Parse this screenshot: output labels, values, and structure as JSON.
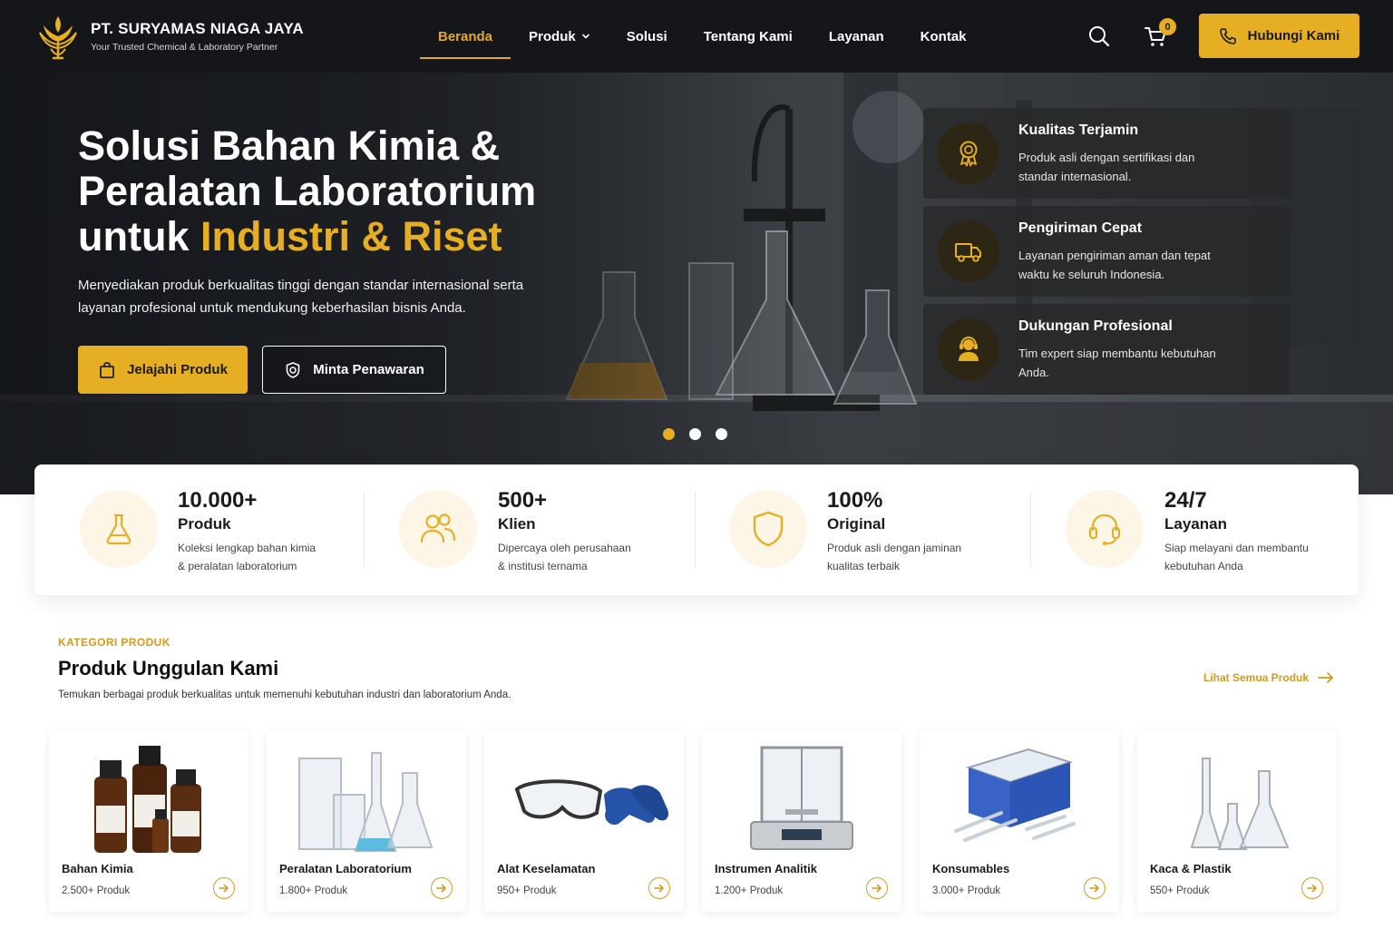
{
  "colors": {
    "accent": "#e6ae22",
    "nav_bg": "#14161a",
    "text_dark": "#1b1b1b"
  },
  "brand": {
    "name": "PT. SURYAMAS NIAGA JAYA",
    "tagline": "Your Trusted Chemical & Laboratory Partner",
    "logo_icon": "lotus-logo-icon"
  },
  "nav": {
    "items": [
      {
        "label": "Beranda",
        "active": true
      },
      {
        "label": "Produk",
        "dropdown": true
      },
      {
        "label": "Solusi"
      },
      {
        "label": "Tentang Kami"
      },
      {
        "label": "Layanan"
      },
      {
        "label": "Kontak"
      }
    ],
    "cart_count": "0",
    "cta_label": "Hubungi Kami"
  },
  "hero": {
    "title_line1": "Solusi Bahan Kimia &",
    "title_line2": "Peralatan Laboratorium",
    "title_line3_prefix": "untuk ",
    "title_line3_accent": "Industri & Riset",
    "description": "Menyediakan produk berkualitas tinggi dengan standar internasional serta layanan profesional untuk mendukung keberhasilan bisnis Anda.",
    "primary_button": "Jelajahi Produk",
    "secondary_button": "Minta Penawaran",
    "slide_count": 3,
    "active_slide": 1,
    "features": [
      {
        "title": "Kualitas Terjamin",
        "desc": "Produk asli dengan sertifikasi dan standar internasional.",
        "icon": "award-icon"
      },
      {
        "title": "Pengiriman Cepat",
        "desc": "Layanan pengiriman aman dan tepat waktu ke seluruh Indonesia.",
        "icon": "truck-icon"
      },
      {
        "title": "Dukungan Profesional",
        "desc": "Tim expert siap membantu kebutuhan Anda.",
        "icon": "support-agent-icon"
      }
    ]
  },
  "stats": [
    {
      "value": "10.000+",
      "label": "Produk",
      "desc_line1": "Koleksi lengkap bahan kimia",
      "desc_line2": "& peralatan laboratorium",
      "icon": "flask-icon"
    },
    {
      "value": "500+",
      "label": "Klien",
      "desc_line1": "Dipercaya oleh perusahaan",
      "desc_line2": "& institusi ternama",
      "icon": "users-icon"
    },
    {
      "value": "100%",
      "label": "Original",
      "desc_line1": "Produk asli dengan jaminan",
      "desc_line2": "kualitas terbaik",
      "icon": "shield-icon"
    },
    {
      "value": "24/7",
      "label": "Layanan",
      "desc_line1": "Siap melayani dan membantu",
      "desc_line2": "kebutuhan Anda",
      "icon": "headset-icon"
    }
  ],
  "categories": {
    "eyebrow": "KATEGORI PRODUK",
    "title": "Produk Unggulan Kami",
    "subtitle": "Temukan berbagai produk berkualitas untuk memenuhi kebutuhan industri dan laboratorium Anda.",
    "see_all": "Lihat Semua Produk",
    "items": [
      {
        "name": "Bahan Kimia",
        "count": "2.500+ Produk",
        "image": "chemical-bottles-image"
      },
      {
        "name": "Peralatan Laboratorium",
        "count": "1.800+ Produk",
        "image": "lab-glassware-image"
      },
      {
        "name": "Alat Keselamatan",
        "count": "950+ Produk",
        "image": "safety-goggles-gloves-image"
      },
      {
        "name": "Instrumen Analitik",
        "count": "1.200+ Produk",
        "image": "analytical-balance-image"
      },
      {
        "name": "Konsumables",
        "count": "3.000+ Produk",
        "image": "pipette-tips-box-image"
      },
      {
        "name": "Kaca & Plastik",
        "count": "550+ Produk",
        "image": "glass-flasks-image"
      }
    ]
  }
}
